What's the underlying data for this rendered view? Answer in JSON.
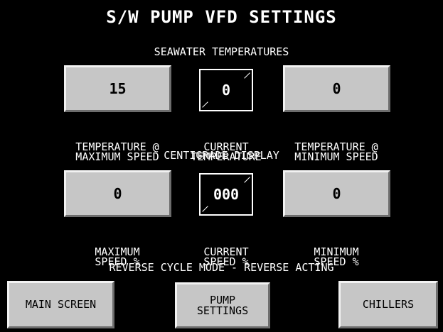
{
  "title": "S/W PUMP VFD SETTINGS",
  "temperatures": {
    "heading": "SEAWATER TEMPERATURES",
    "max_speed_temp": {
      "value": "15",
      "label_line1": "TEMPERATURE @",
      "label_line2": "MAXIMUM SPEED"
    },
    "current_temp": {
      "value": "0",
      "label_line1": "CURRENT",
      "label_line2": "TEMPERATURE"
    },
    "min_speed_temp": {
      "value": "0",
      "label_line1": "TEMPERATURE @",
      "label_line2": "MINIMUM SPEED"
    },
    "units_note": "CENTIGRADE DISPLAY"
  },
  "speeds": {
    "max_speed": {
      "value": "0",
      "label_line1": "MAXIMUM",
      "label_line2": "SPEED %"
    },
    "current_speed": {
      "value": "000",
      "label_line1": "CURRENT",
      "label_line2": "SPEED %"
    },
    "min_speed": {
      "value": "0",
      "label_line1": "MINIMUM",
      "label_line2": "SPEED %"
    }
  },
  "mode_text": "REVERSE CYCLE MODE - REVERSE ACTING",
  "nav": {
    "main_screen": "MAIN SCREEN",
    "pump_settings_line1": "PUMP",
    "pump_settings_line2": "SETTINGS",
    "chillers": "CHILLERS"
  },
  "colors": {
    "background": "#000000",
    "panel": "#c6c6c6",
    "text": "#ffffff"
  }
}
